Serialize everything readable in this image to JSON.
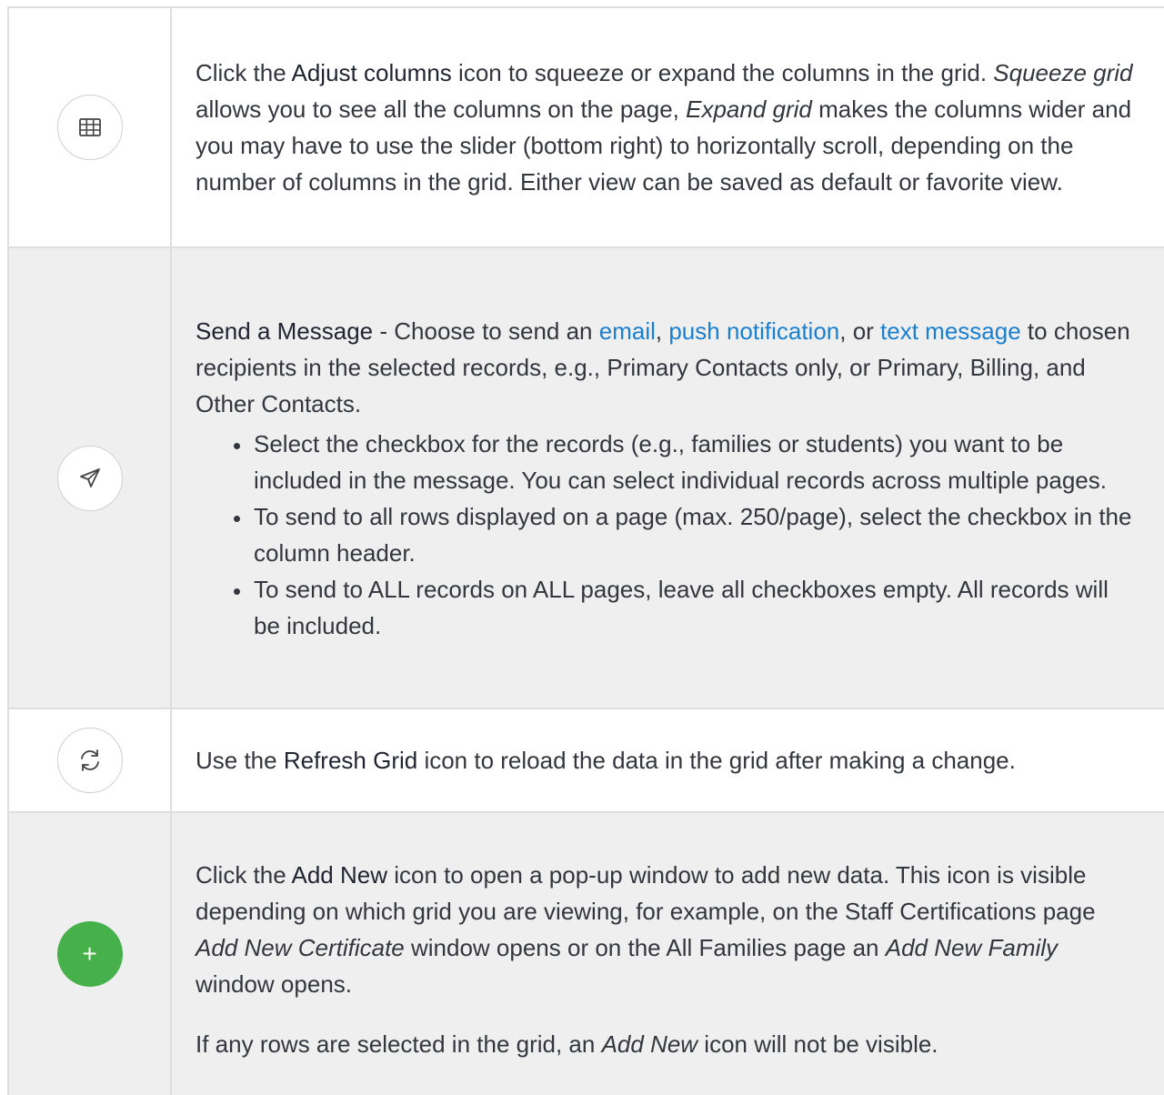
{
  "rows": [
    {
      "icon": "grid-table-icon",
      "bold": "Adjust columns",
      "pre": "Click the ",
      "mid1": " icon to squeeze or expand the columns in the grid. ",
      "em1": "Squeeze grid",
      "mid2": " allows you to see all the columns on the page, ",
      "em2": "Expand grid",
      "post": " makes the columns wider and you may have to use the slider (bottom right) to horizontally scroll, depending on the number of columns in the grid. Either view can be saved as default or favorite view."
    },
    {
      "icon": "paper-plane-icon",
      "bold": "Send a Message",
      "pre": " - Choose to send an ",
      "link1": "email",
      "sep1": ", ",
      "link2": "push notification",
      "sep2": ", or ",
      "link3": "text message",
      "post": " to chosen recipients in the selected records, e.g., Primary Contacts only, or Primary, Billing, and Other Contacts.",
      "bullets": [
        "Select the checkbox for the records (e.g., families or students) you want to be included in the message. You can select individual records across multiple pages.",
        "To send to all rows displayed on a page (max. 250/page), select the checkbox in the column header.",
        "To send to ALL records on ALL pages, leave all checkboxes empty. All records will be included."
      ]
    },
    {
      "icon": "refresh-icon",
      "pre": "Use the ",
      "bold": "Refresh Grid",
      "post": " icon to reload the data in the grid after making a change."
    },
    {
      "icon": "plus-icon",
      "icon_glyph": "+",
      "pre": "Click the ",
      "bold": "Add New",
      "mid1": " icon to open a pop-up window to add new data. This icon is visible depending on which grid you are viewing, for example, on the Staff Certifications page ",
      "em1": "Add New Certificate",
      "mid2": " window opens or on the All Families page an ",
      "em2": "Add New Family",
      "post": " window opens.",
      "p2_pre": "If any rows are selected in the grid, an ",
      "p2_em": "Add New",
      "p2_post": " icon will not be visible."
    }
  ],
  "colors": {
    "link": "#1a7fcf",
    "add_button": "#46b04b",
    "row_alt": "#efefef",
    "border": "#dedede"
  }
}
